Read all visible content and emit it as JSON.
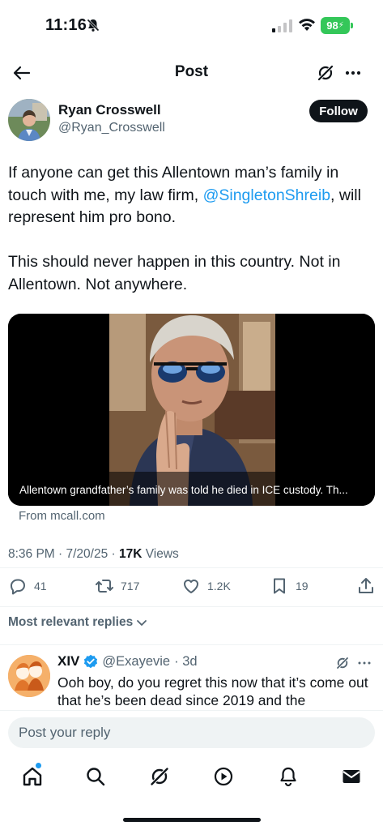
{
  "status_bar": {
    "time": "11:16",
    "battery": "98"
  },
  "header": {
    "title": "Post"
  },
  "author": {
    "name": "Ryan Crosswell",
    "handle": "@Ryan_Crosswell",
    "follow_label": "Follow"
  },
  "tweet": {
    "text_before_mention": "If anyone can get this Allentown man’s family in touch with me, my law firm, ",
    "mention": "@SingletonShreib",
    "text_after_mention": ", will represent him pro bono.",
    "paragraph2": "This should never happen in this country. Not in Allentown. Not anywhere."
  },
  "media": {
    "caption": "Allentown grandfather’s family was told he died in ICE custody. Th...",
    "source": "From mcall.com"
  },
  "meta": {
    "time_date": "8:36 PM · 7/20/25 · ",
    "views_count": "17K",
    "views_label": " Views"
  },
  "actions": {
    "replies": "41",
    "reposts": "717",
    "likes": "1.2K",
    "bookmarks": "19"
  },
  "sort": {
    "label": "Most relevant replies"
  },
  "reply": {
    "name": "XIV",
    "handle": "@Exayevie",
    "age": "· 3d",
    "text": "Ooh boy, do you regret this now that it’s come out that he’s been dead since 2019 and the"
  },
  "compose": {
    "placeholder": "Post your reply"
  },
  "colors": {
    "accent": "#1d9bf0",
    "text": "#0f1419",
    "muted": "#536471",
    "battery": "#34c759"
  }
}
